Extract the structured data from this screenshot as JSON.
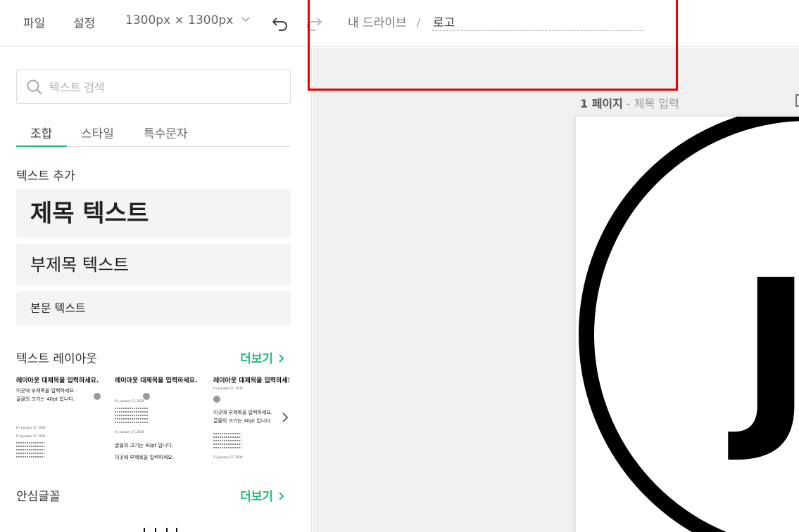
{
  "topbar": {
    "menu_file": "파일",
    "menu_settings": "설정",
    "canvas_size": "1300px × 1300px",
    "breadcrumb_root": "내 드라이브",
    "breadcrumb_sep": "/",
    "document_title": "로고"
  },
  "panel": {
    "search_placeholder": "텍스트 검색",
    "tabs": [
      {
        "label": "조합",
        "active": true
      },
      {
        "label": "스타일",
        "active": false
      },
      {
        "label": "특수문자",
        "active": false
      }
    ],
    "add_text_title": "텍스트 추가",
    "heading_text": "제목 텍스트",
    "subheading_text": "부제목 텍스트",
    "body_text": "본문 텍스트",
    "layout_title": "텍스트 레이아웃",
    "more_label": "더보기",
    "safe_fonts_title": "안심글꼴",
    "layouts": [
      {
        "title": "레이아웃 대제목을 입력하세요.",
        "line1": "이곳에 부제목을 입력하세요.",
        "line2": "글꼴의 크기는 40pt 입니다.",
        "date1": "Fri, January 17, 2030",
        "date2": "Fri, January 17, 2030"
      },
      {
        "title": "레이아웃 대제목을 입력하세요.",
        "date1": "Fri, January 17, 2030",
        "date2": "Fri, January 17, 2030",
        "line1": "글꼴의 크기는 40pt 입니다.",
        "line2": "이곳에 부제목을 입력하세요."
      },
      {
        "title": "레이아웃 대제목을 입력하세요.",
        "date1": "Fri, January 17, 2030",
        "line1": "이곳에 부제목을 입력하세요.",
        "line2": "글꼴의 크기는 40pt 입니다.",
        "date2": "Fri, January 17, 2030"
      }
    ]
  },
  "canvas": {
    "page_number": "1 페이지",
    "page_title": "- 제목 입력",
    "logo_letter": "J"
  },
  "colors": {
    "accent": "#1fbd7a",
    "highlight": "#e60000",
    "workspace_bg": "#f0f0f0"
  },
  "icons": {
    "size_dropdown": "chevron-down-icon",
    "undo": "undo-icon",
    "redo": "redo-icon",
    "search": "search-icon",
    "more": "chevron-right-icon",
    "layout_next": "chevron-right-icon",
    "page_tool": "page-options-icon"
  }
}
